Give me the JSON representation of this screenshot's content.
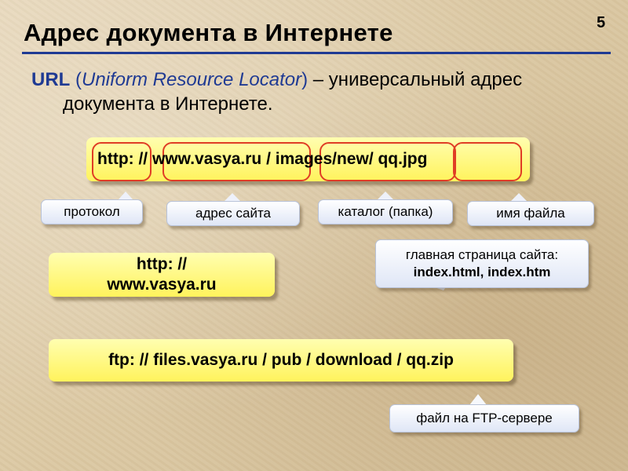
{
  "slide": {
    "number": "5",
    "title": "Адрес документа в Интернете"
  },
  "definition": {
    "term": "URL",
    "open_paren": " (",
    "expansion": "Uniform Resource Locator",
    "close_paren": ")",
    "rest_line1": " – универсальный адрес",
    "rest_line2": "документа в Интернете."
  },
  "url_example": {
    "text": "http: // www.vasya.ru / images/new/ qq.jpg"
  },
  "callouts": {
    "protocol": "протокол",
    "site": "адрес сайта",
    "directory": "каталог (папка)",
    "file": "имя файла"
  },
  "homepage_example": {
    "line1": "http: //",
    "line2": "www.vasya.ru"
  },
  "homepage_callout": {
    "line1": "главная страница сайта:",
    "line2": "index.html, index.htm"
  },
  "ftp_example": {
    "text": "ftp: // files.vasya.ru / pub / download / qq.zip"
  },
  "ftp_callout": {
    "text": "файл на FTP-сервере"
  },
  "colors": {
    "title_rule": "#1f3a93",
    "highlight_oval": "#e03d25",
    "yellow_box": "#fff35c",
    "callout_fill": "#dfe6f6"
  }
}
